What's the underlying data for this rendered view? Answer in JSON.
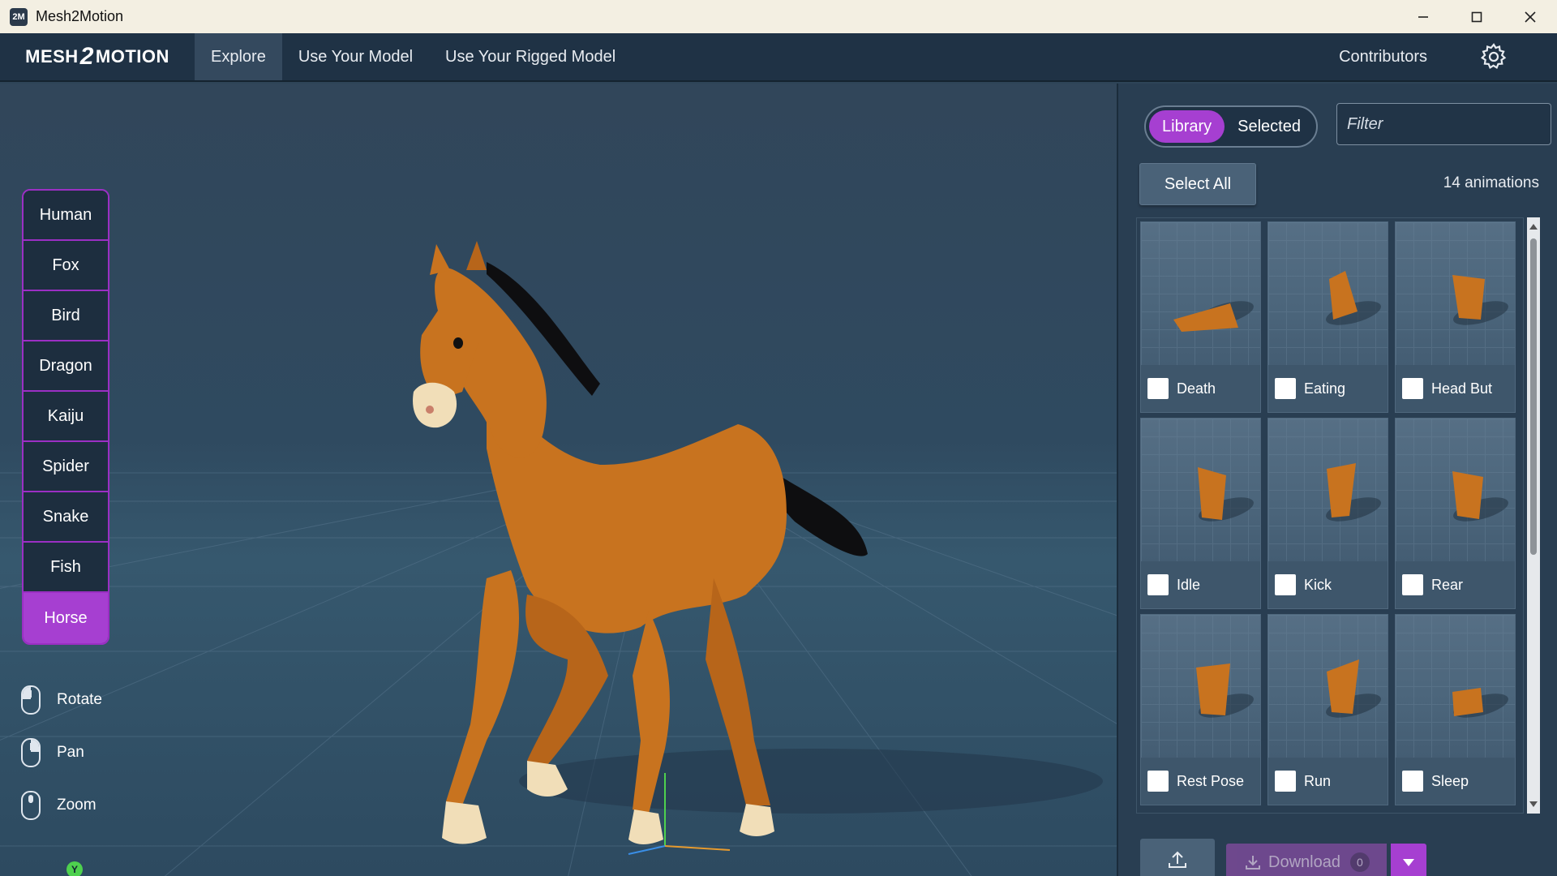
{
  "window": {
    "title": "Mesh2Motion",
    "icon_text": "2M"
  },
  "navbar": {
    "logo": {
      "left": "MESH",
      "mid": "2",
      "right": "MOTION"
    },
    "tabs": [
      {
        "label": "Explore",
        "active": true
      },
      {
        "label": "Use Your Model",
        "active": false
      },
      {
        "label": "Use Your Rigged Model",
        "active": false
      }
    ],
    "contributors": "Contributors",
    "settings_icon": "gear-icon"
  },
  "models": [
    {
      "label": "Human"
    },
    {
      "label": "Fox"
    },
    {
      "label": "Bird"
    },
    {
      "label": "Dragon"
    },
    {
      "label": "Kaiju"
    },
    {
      "label": "Spider"
    },
    {
      "label": "Snake"
    },
    {
      "label": "Fish"
    },
    {
      "label": "Horse",
      "active": true
    }
  ],
  "controls": {
    "rotate": "Rotate",
    "pan": "Pan",
    "zoom": "Zoom",
    "axis_label": "Y"
  },
  "panel": {
    "toggle": {
      "library": "Library",
      "selected": "Selected"
    },
    "filter_placeholder": "Filter",
    "select_all": "Select All",
    "count": "14 animations",
    "animations": [
      {
        "name": "Death"
      },
      {
        "name": "Eating"
      },
      {
        "name": "Head But"
      },
      {
        "name": "Idle"
      },
      {
        "name": "Kick"
      },
      {
        "name": "Rear"
      },
      {
        "name": "Rest Pose"
      },
      {
        "name": "Run"
      },
      {
        "name": "Sleep"
      }
    ],
    "download_label": "Download",
    "download_count": "0"
  },
  "colors": {
    "accent": "#a63fd1",
    "navbar": "#1f3245",
    "horse": "#c8731f"
  }
}
